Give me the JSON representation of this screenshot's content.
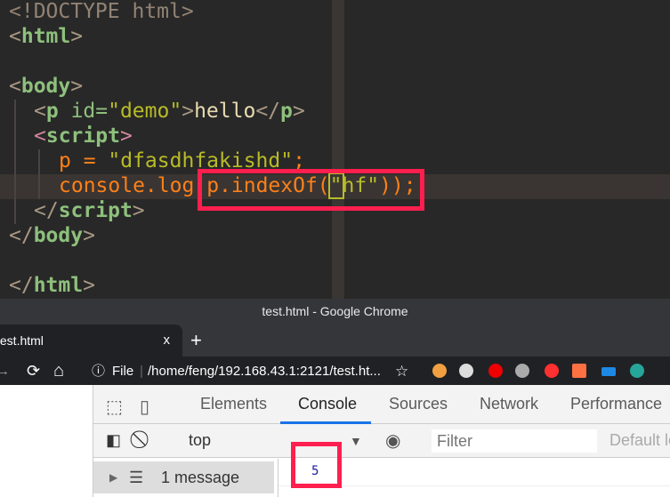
{
  "editor": {
    "lines": {
      "l1": "<!DOCTYPE html>",
      "l2_open": "<",
      "l2_tag": "html",
      "l2_close": ">",
      "l4_open": "<",
      "l4_tag": "body",
      "l4_close": ">",
      "l5_a": "<",
      "l5_tag": "p",
      "l5_attr": " id=",
      "l5_val": "\"demo\"",
      "l5_b": ">",
      "l5_text": "hello",
      "l5_c": "</",
      "l5_tag2": "p",
      "l5_d": ">",
      "l6_a": "<",
      "l6_tag": "script",
      "l6_b": ">",
      "l7_var": "p = ",
      "l7_str": "\"dfasdhfakishd\"",
      "l7_semi": ";",
      "l8_call": "console.log",
      "l8_expr": "p.indexOf(",
      "l8_q": "\"",
      "l8_str": "hf\"",
      "l8_end": "));",
      "l9_a": "</",
      "l9_tag": "script",
      "l9_b": ">",
      "l10_a": "</",
      "l10_tag": "body",
      "l10_b": ">",
      "l12_a": "</",
      "l12_tag": "html",
      "l12_b": ">"
    }
  },
  "browser": {
    "window_title": "test.html - Google Chrome",
    "tab_title": "test.html",
    "tab_close": "x",
    "new_tab": "+",
    "toolbar": {
      "forward": "→",
      "reload": "⟳",
      "home": "⌂",
      "info": "ⓘ",
      "scheme": "File",
      "url": "/home/feng/192.168.43.1:2121/test.ht...",
      "star": "☆"
    },
    "extensions": [
      "#f0a040",
      "#dddddd",
      "#e00000",
      "#aaaaaa",
      "#ff3030",
      "#ff7043",
      "#1e88e5",
      "#26a69a"
    ]
  },
  "devtools": {
    "tabs": [
      "Elements",
      "Console",
      "Sources",
      "Network",
      "Performance"
    ],
    "active_tab": "Console",
    "context": "top",
    "filter_placeholder": "Filter",
    "levels": "Default le",
    "sidebar": {
      "messages": "1 message"
    },
    "output": {
      "value": "5"
    }
  },
  "colors": {
    "highlight": "#ff1f4f",
    "accent": "#1a73e8"
  }
}
